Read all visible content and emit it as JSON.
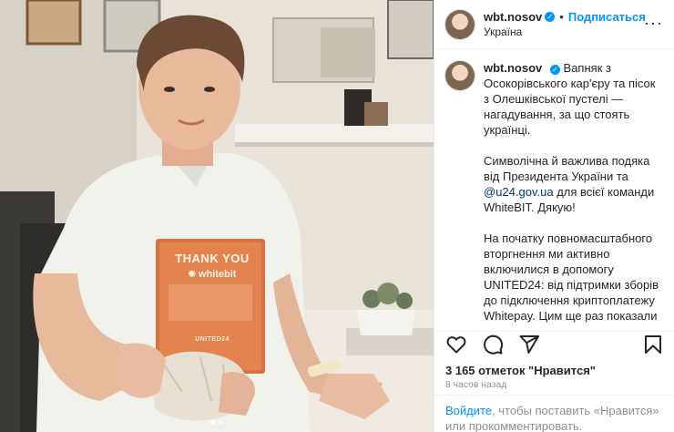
{
  "post": {
    "username": "wbt.nosov",
    "follow_label": "Подписаться",
    "location": "Україна",
    "more_icon": "more-horizontal-icon"
  },
  "photo": {
    "plaque_title": "THANK YOU",
    "plaque_brand": "whitebit",
    "plaque_footer": "UNITED24"
  },
  "caption": {
    "para1": "Вапняк з Осокорівського кар'єру та пісок з Олешківської пустелі — нагадування, за що стоять українці.",
    "para2_before": "Символічна й важлива подяка від Президента України та ",
    "para2_mention": "@u24.gov.ua",
    "para2_after": " для всієї команди WhiteBIT. Дякую!",
    "para3": "На початку повномасштабного вторгнення ми активно включилися в допомогу UNITED24: від підтримки зборів до підключення криптоплатежу Whitepay. Цим ще раз показали простоту, безпечність і швидкість криптодонатингу 💪"
  },
  "actions": {
    "like_icon": "heart-icon",
    "comment_icon": "comment-icon",
    "share_icon": "share-icon",
    "save_icon": "bookmark-icon"
  },
  "stats": {
    "likes": "3 165 отметок \"Нравится\"",
    "time": "8 часов назад"
  },
  "login": {
    "link": "Войдите",
    "rest": ", чтобы поставить «Нравится» или прокомментировать."
  },
  "colors": {
    "accent": "#0095f6",
    "mention": "#00376b",
    "plaque": "#d9703f"
  }
}
